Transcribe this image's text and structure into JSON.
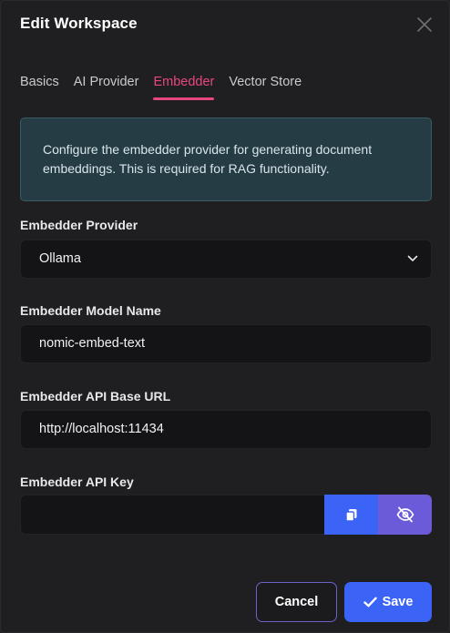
{
  "modal": {
    "title": "Edit Workspace"
  },
  "tabs": [
    {
      "label": "Basics",
      "active": false
    },
    {
      "label": "AI Provider",
      "active": false
    },
    {
      "label": "Embedder",
      "active": true
    },
    {
      "label": "Vector Store",
      "active": false
    }
  ],
  "info": {
    "line1": "Configure the embedder provider for generating document",
    "line2": "embeddings. This is required for RAG functionality."
  },
  "fields": {
    "provider": {
      "label": "Embedder Provider",
      "value": "Ollama"
    },
    "model": {
      "label": "Embedder Model Name",
      "value": "nomic-embed-text"
    },
    "base_url": {
      "label": "Embedder API Base URL",
      "value": "http://localhost:11434"
    },
    "api_key": {
      "label": "Embedder API Key",
      "value": ""
    }
  },
  "buttons": {
    "cancel": "Cancel",
    "save": "Save"
  },
  "icons": {
    "close": "close-icon",
    "chevron": "chevron-down-icon",
    "copy": "copy-icon",
    "eye": "eye-off-icon",
    "check": "check-icon"
  },
  "colors": {
    "accent_tab": "#e8477d",
    "primary": "#3b63f5",
    "secondary": "#6b5bd8",
    "info_bg": "#263c45"
  }
}
